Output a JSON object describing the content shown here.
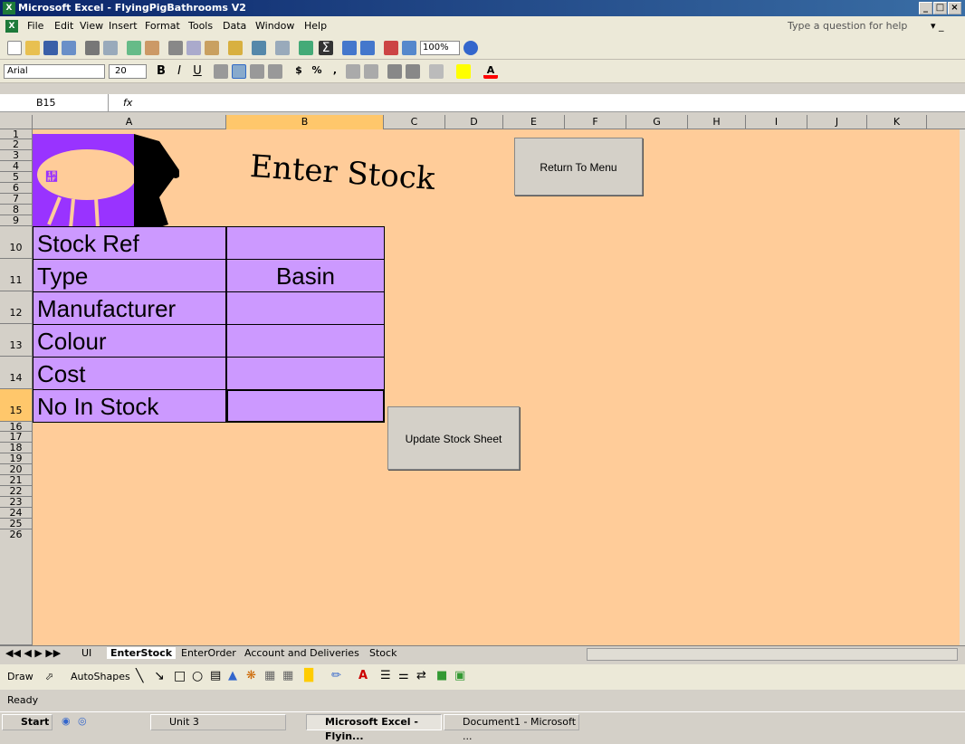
{
  "window": {
    "title": "Microsoft Excel - FlyingPigBathrooms V2",
    "controls": [
      "_",
      "□",
      "×"
    ]
  },
  "menu": {
    "items": [
      "File",
      "Edit",
      "View",
      "Insert",
      "Format",
      "Tools",
      "Data",
      "Window",
      "Help"
    ],
    "help_placeholder": "Type a question for help"
  },
  "toolbar": {
    "zoom": "100%",
    "font": "Arial",
    "font_size": "20"
  },
  "formula_bar": {
    "name_box": "B15",
    "fx": "fx",
    "value": ""
  },
  "columns": [
    "A",
    "B",
    "C",
    "D",
    "E",
    "F",
    "G",
    "H",
    "I",
    "J",
    "K"
  ],
  "rows": [
    "1",
    "2",
    "3",
    "4",
    "5",
    "6",
    "7",
    "8",
    "9",
    "10",
    "11",
    "12",
    "13",
    "14",
    "15",
    "16",
    "17",
    "18",
    "19",
    "20",
    "21",
    "22",
    "23",
    "24",
    "25",
    "26"
  ],
  "sheet": {
    "heading": "Enter Stock",
    "fields": [
      {
        "label": "Stock Ref",
        "value": ""
      },
      {
        "label": "Type",
        "value": "Basin"
      },
      {
        "label": "Manufacturer",
        "value": ""
      },
      {
        "label": "Colour",
        "value": ""
      },
      {
        "label": "Cost",
        "value": ""
      },
      {
        "label": "No In Stock",
        "value": ""
      }
    ],
    "return_button": "Return To Menu",
    "update_button": "Update Stock Sheet"
  },
  "tabs": {
    "items": [
      "UI",
      "EnterStock",
      "EnterOrder",
      "Account and Deliveries",
      "Stock"
    ],
    "active": "EnterStock"
  },
  "drawbar": {
    "draw": "Draw",
    "autoshapes": "AutoShapes"
  },
  "status": {
    "text": "Ready"
  },
  "taskbar": {
    "start": "Start",
    "tasks": [
      "Unit 3",
      "Microsoft Excel - Flyin...",
      "Document1 - Microsoft ..."
    ]
  },
  "colors": {
    "sheet_bg": "#ffcc99",
    "cell_bg": "#cc99ff",
    "title_bar": "#0a246a"
  }
}
